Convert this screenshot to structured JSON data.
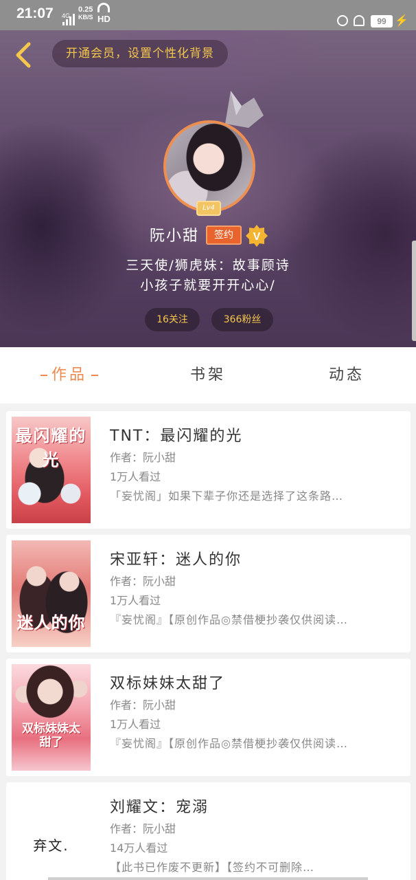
{
  "status_bar": {
    "time": "21:07",
    "network": "4G",
    "speed_value": "0.25",
    "speed_unit": "KB/S",
    "hd": "HD",
    "battery": "99"
  },
  "header": {
    "vip_banner": "开通会员，设置个性化背景",
    "level": "Lv4",
    "username": "阮小甜",
    "signed_badge": "签约",
    "verified_badge": "V",
    "bio_line1": "三天使/狮虎妹：故事顾诗",
    "bio_line2": "小孩子就要开开心心/",
    "following": "16关注",
    "fans": "366粉丝"
  },
  "tabs": [
    {
      "label": "作品",
      "active": true
    },
    {
      "label": "书架",
      "active": false
    },
    {
      "label": "动态",
      "active": false
    }
  ],
  "books": [
    {
      "title": "TNT：最闪耀的光",
      "author": "作者：阮小甜",
      "reads": "1万人看过",
      "desc": "「妄忧阁」如果下辈子你还是选择了这条路…",
      "cover_text": "最闪耀的光"
    },
    {
      "title": "宋亚轩：迷人的你",
      "author": "作者：阮小甜",
      "reads": "1万人看过",
      "desc": "『妄忧阁』【原创作品◎禁借梗抄袭仅供阅读…",
      "cover_text": "迷人的你"
    },
    {
      "title": "双标妹妹太甜了",
      "author": "作者：阮小甜",
      "reads": "1万人看过",
      "desc": "『妄忧阁』【原创作品◎禁借梗抄袭仅供阅读…",
      "cover_text": "双标妹妹太甜了"
    },
    {
      "title": "刘耀文：宠溺",
      "author": "作者：阮小甜",
      "reads": "14万人看过",
      "desc": "【此书已作废不更新】【签约不可删除…",
      "cover_text": "弃文."
    }
  ],
  "colors": {
    "accent": "#ee8a4f",
    "gold": "#f5c74c",
    "signed": "#e8642c"
  }
}
